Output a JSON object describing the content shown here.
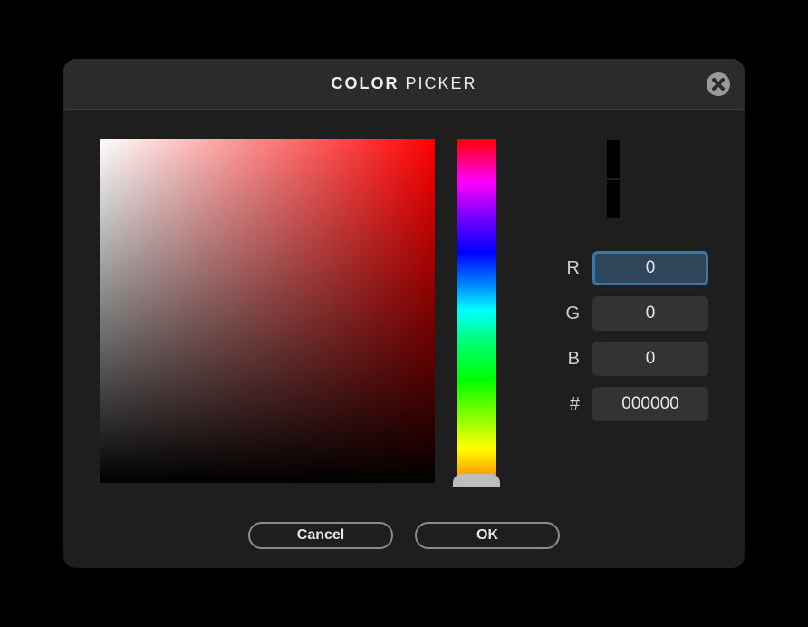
{
  "dialog": {
    "title_bold": "COLOR",
    "title_light": "PICKER"
  },
  "swatches": {
    "new_color": "#000000",
    "old_color": "#000000"
  },
  "rgb": {
    "r_label": "R",
    "r_value": "0",
    "g_label": "G",
    "g_value": "0",
    "b_label": "B",
    "b_value": "0",
    "hex_label": "#",
    "hex_value": "000000"
  },
  "picker": {
    "base_hue_color": "#ff0000",
    "hue_position": 1.0
  },
  "buttons": {
    "cancel": "Cancel",
    "ok": "OK"
  },
  "focused_field": "r"
}
